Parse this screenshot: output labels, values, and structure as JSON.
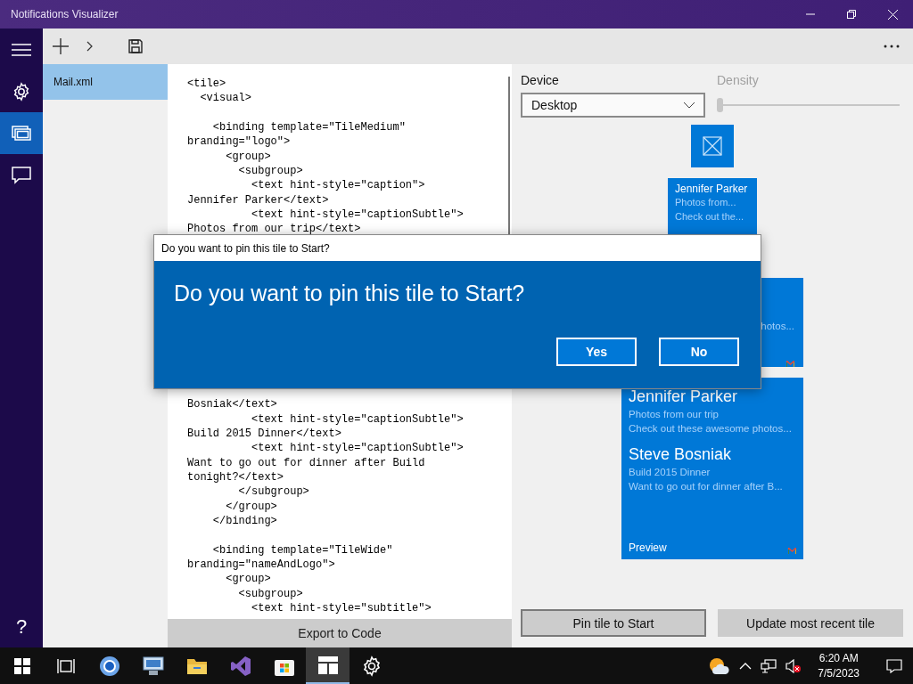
{
  "window": {
    "title": "Notifications Visualizer"
  },
  "nav": {
    "items": [
      {
        "kind": "settings",
        "selected": false
      },
      {
        "kind": "tiles",
        "selected": true
      },
      {
        "kind": "feedback",
        "selected": false
      }
    ],
    "help": "?"
  },
  "files": [
    {
      "name": "Mail.xml",
      "selected": true
    }
  ],
  "editor": {
    "top_blocks": [
      [
        "<tile>",
        "  <visual>"
      ],
      [
        "    <binding template=\"TileMedium\"",
        "branding=\"logo\">",
        "      <group>",
        "        <subgroup>",
        "          <text hint-style=\"caption\">",
        "Jennifer Parker</text>",
        "          <text hint-style=\"captionSubtle\">",
        "Photos from our trip</text>"
      ]
    ],
    "bottom_blocks": [
      [
        "Bosniak</text>",
        "          <text hint-style=\"captionSubtle\">",
        "Build 2015 Dinner</text>",
        "          <text hint-style=\"captionSubtle\">",
        "Want to go out for dinner after Build",
        "tonight?</text>",
        "        </subgroup>",
        "      </group>",
        "    </binding>"
      ],
      [
        "    <binding template=\"TileWide\"",
        "branding=\"nameAndLogo\">",
        "      <group>",
        "        <subgroup>",
        "          <text hint-style=\"subtitle\">"
      ]
    ],
    "export_button": "Export to Code"
  },
  "preview": {
    "device_label": "Device",
    "device_value": "Desktop",
    "density_label": "Density",
    "density": {
      "level": 0,
      "disabled": true
    },
    "tiles": [
      {
        "kind": "small"
      },
      {
        "kind": "medium",
        "groups": [
          {
            "title": "Jennifer Parker",
            "lines": [
              "Photos from...",
              "Check out the..."
            ]
          }
        ]
      },
      {
        "kind": "wide",
        "groups": [
          {
            "lines": [
              "hotos..."
            ]
          }
        ],
        "logo": true
      },
      {
        "kind": "large",
        "groups": [
          {
            "title": "Jennifer Parker",
            "lines": [
              "Photos from our trip",
              "Check out these awesome photos..."
            ]
          },
          {
            "title": "Steve Bosniak",
            "lines": [
              "Build 2015 Dinner",
              "Want to go out for dinner after B..."
            ]
          }
        ],
        "label": "Preview",
        "logo": true
      }
    ],
    "buttons": [
      {
        "label": "Pin tile to Start",
        "focused": true
      },
      {
        "label": "Update most recent tile",
        "focused": false
      }
    ]
  },
  "dialog": {
    "title": "Do you want to pin this tile to Start?",
    "message": "Do you want to pin this tile to Start?",
    "buttons": [
      "Yes",
      "No"
    ]
  },
  "taskbar": {
    "apps": [
      {
        "kind": "start",
        "active": false
      },
      {
        "kind": "taskview",
        "active": false
      },
      {
        "kind": "browser",
        "active": false
      },
      {
        "kind": "computer",
        "active": false
      },
      {
        "kind": "folder",
        "active": false
      },
      {
        "kind": "studio",
        "active": false
      },
      {
        "kind": "store",
        "active": false
      },
      {
        "kind": "tiles",
        "active": true
      },
      {
        "kind": "settings",
        "active": false
      }
    ],
    "time": "6:20 AM",
    "date": "7/5/2023"
  }
}
